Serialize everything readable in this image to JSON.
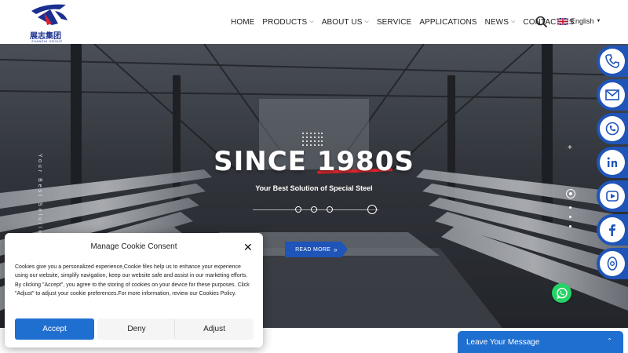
{
  "header": {
    "logo_cn": "展志集团",
    "logo_en": "ZHANZHI GROUP",
    "nav": [
      {
        "label": "HOME",
        "dropdown": false
      },
      {
        "label": "PRODUCTS",
        "dropdown": true
      },
      {
        "label": "ABOUT US",
        "dropdown": true
      },
      {
        "label": "SERVICE",
        "dropdown": false
      },
      {
        "label": "APPLICATIONS",
        "dropdown": false
      },
      {
        "label": "NEWS",
        "dropdown": true
      },
      {
        "label": "CONTACT US",
        "dropdown": false
      }
    ],
    "language": "English"
  },
  "hero": {
    "vertical_text": "Your Best Solution of Spec",
    "title": "SINCE 1980S",
    "subtitle": "Your Best Solution of Special Steel",
    "read_more": "READ MORE"
  },
  "social": [
    {
      "icon": "phone-icon"
    },
    {
      "icon": "mail-icon"
    },
    {
      "icon": "skype-icon"
    },
    {
      "icon": "linkedin-icon"
    },
    {
      "icon": "youtube-icon"
    },
    {
      "icon": "facebook-icon"
    },
    {
      "icon": "instagram-icon"
    }
  ],
  "cookie": {
    "title": "Manage Cookie Consent",
    "body": "Cookies give you a personalized experience,Cookie files help us to enhance your experience using our website, simplify navigation, keep our website safe and assist in our marketing efforts. By clicking \"Accept\", you agree to the storing of cookies on your device for these purposes. Click \"Adjust\" to adjust your cookie preferences.For more information, review our Cookies Policy.",
    "accept": "Accept",
    "deny": "Deny",
    "adjust": "Adjust"
  },
  "leave_message": "Leave Your Message",
  "colors": {
    "brand_blue": "#1f54b8",
    "accent_red": "#d8262e",
    "chat_blue": "#1f6fd0",
    "whatsapp_green": "#25d366"
  }
}
